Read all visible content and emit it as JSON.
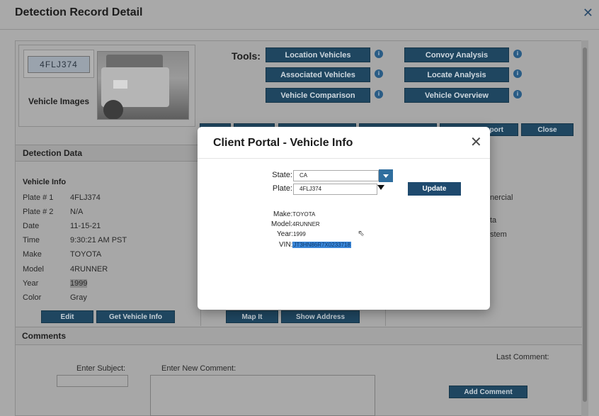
{
  "window": {
    "title": "Detection Record Detail",
    "close_glyph": "✕"
  },
  "images": {
    "label": "Vehicle Images",
    "plate_text": "4FLJ374"
  },
  "tools": {
    "label": "Tools:",
    "buttons": [
      {
        "label": "Location Vehicles"
      },
      {
        "label": "Associated Vehicles"
      },
      {
        "label": "Vehicle Comparison"
      },
      {
        "label": "Convoy Analysis"
      },
      {
        "label": "Locate Analysis"
      },
      {
        "label": "Vehicle Overview"
      }
    ],
    "info_glyph": "i"
  },
  "toolbar": {
    "export_fragment": "port",
    "close_label": "Close"
  },
  "detection": {
    "section_title": "Detection Data",
    "vehicle_info_title": "Vehicle Info",
    "rows": [
      {
        "label": "Plate # 1",
        "value": "4FLJ374"
      },
      {
        "label": "Plate # 2",
        "value": "N/A"
      },
      {
        "label": "Date",
        "value": "11-15-21"
      },
      {
        "label": "Time",
        "value": "9:30:21 AM PST"
      },
      {
        "label": "Make",
        "value": "TOYOTA"
      },
      {
        "label": "Model",
        "value": "4RUNNER"
      },
      {
        "label": "Year",
        "value": "1999"
      },
      {
        "label": "Color",
        "value": "Gray"
      }
    ],
    "edit_label": "Edit",
    "get_info_label": "Get Vehicle Info"
  },
  "location": {
    "map_label": "Map It",
    "address_label": "Show Address"
  },
  "right_fragments": {
    "f1": "nercial",
    "f2": "ta",
    "f3": "stem"
  },
  "comments": {
    "title": "Comments",
    "subject_label": "Enter Subject:",
    "new_comment_label": "Enter New Comment:",
    "last_comment_label": "Last Comment:",
    "add_label": "Add Comment"
  },
  "modal": {
    "title": "Client Portal - Vehicle Info",
    "close_glyph": "✕",
    "state_label": "State:",
    "state_value": "CA",
    "plate_label": "Plate:",
    "plate_value": "4FLJ374",
    "update_label": "Update",
    "make_label": "Make:",
    "make_value": "TOYOTA",
    "model_label": "Model:",
    "model_value": "4RUNNER",
    "year_label": "Year:",
    "year_value": "1999",
    "vin_label": "VIN:",
    "vin_value": "JT3HN86R7X0233718"
  }
}
